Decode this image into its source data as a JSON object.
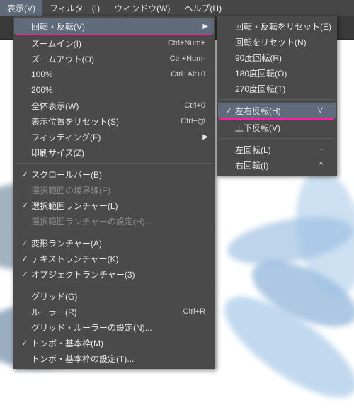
{
  "menubar": {
    "view": "表示(V)",
    "filter": "フィルター(I)",
    "window": "ウィンドウ(W)",
    "help": "ヘルプ(H)"
  },
  "viewMenu": {
    "rotateFlip": {
      "label": "回転・反転(V)"
    },
    "zoomIn": {
      "label": "ズームイン(I)",
      "shortcut": "Ctrl+Num+"
    },
    "zoomOut": {
      "label": "ズームアウト(O)",
      "shortcut": "Ctrl+Num-"
    },
    "pct100": {
      "label": "100%",
      "shortcut": "Ctrl+Alt+0"
    },
    "pct200": {
      "label": "200%"
    },
    "fitAll": {
      "label": "全体表示(W)",
      "shortcut": "Ctrl+0"
    },
    "resetView": {
      "label": "表示位置をリセット(S)",
      "shortcut": "Ctrl+@"
    },
    "fitting": {
      "label": "フィッティング(F)"
    },
    "printSize": {
      "label": "印刷サイズ(Z)"
    },
    "scrollbar": {
      "label": "スクロールバー(B)"
    },
    "selEdge": {
      "label": "選択範囲の境界線(E)"
    },
    "selLauncher": {
      "label": "選択範囲ランチャー(L)"
    },
    "selLauncherCfg": {
      "label": "選択範囲ランチャーの設定(H)..."
    },
    "transform": {
      "label": "変形ランチャー(A)"
    },
    "text": {
      "label": "テキストランチャー(K)"
    },
    "object": {
      "label": "オブジェクトランチャー(3)"
    },
    "grid": {
      "label": "グリッド(G)"
    },
    "ruler": {
      "label": "ルーラー(R)",
      "shortcut": "Ctrl+R"
    },
    "gridRulerCfg": {
      "label": "グリッド・ルーラーの設定(N)..."
    },
    "trimMark": {
      "label": "トンボ・基本枠(M)"
    },
    "trimMarkCfg": {
      "label": "トンボ・基本枠の設定(T)..."
    }
  },
  "rotateSub": {
    "resetBoth": {
      "label": "回転・反転をリセット(E)"
    },
    "resetRot": {
      "label": "回転をリセット(N)"
    },
    "rot90": {
      "label": "90度回転(R)"
    },
    "rot180": {
      "label": "180度回転(O)"
    },
    "rot270": {
      "label": "270度回転(T)"
    },
    "flipH": {
      "label": "左右反転(H)",
      "shortcut": "V"
    },
    "flipV": {
      "label": "上下反転(V)"
    },
    "rotL": {
      "label": "左回転(L)",
      "shortcut": "-"
    },
    "rotR": {
      "label": "右回転(I)",
      "shortcut": "^"
    }
  },
  "glyphs": {
    "check": "✓",
    "arrow": "▶"
  }
}
